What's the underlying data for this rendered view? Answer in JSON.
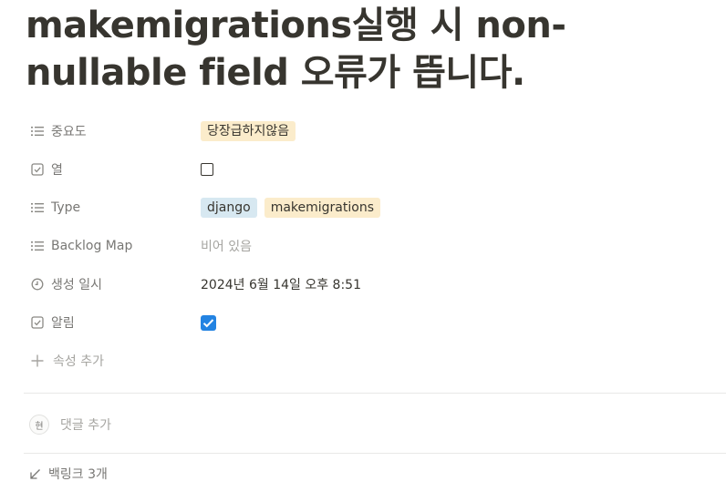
{
  "page": {
    "title": "makemigrations실행 시 non-nullable field 오류가 뜹니다."
  },
  "properties": [
    {
      "name": "중요도",
      "icon": "list-icon",
      "type": "select",
      "tags": [
        {
          "label": "당장급하지않음",
          "color": "#fbeccb"
        }
      ]
    },
    {
      "name": "열",
      "icon": "checkbox-icon",
      "type": "checkbox",
      "checked": false
    },
    {
      "name": "Type",
      "icon": "list-icon",
      "type": "multi_select",
      "tags": [
        {
          "label": "django",
          "color": "#d7e8f1"
        },
        {
          "label": "makemigrations",
          "color": "#fbeccb"
        }
      ]
    },
    {
      "name": "Backlog Map",
      "icon": "list-icon",
      "type": "empty",
      "value": "비어 있음"
    },
    {
      "name": "생성 일시",
      "icon": "clock-icon",
      "type": "date",
      "value": "2024년 6월 14일 오후 8:51"
    },
    {
      "name": "알림",
      "icon": "checkbox-icon",
      "type": "checkbox",
      "checked": true
    }
  ],
  "add_property_label": "속성 추가",
  "comment": {
    "avatar_initial": "현",
    "placeholder": "댓글 추가"
  },
  "backlinks": {
    "label": "백링크 3개"
  },
  "colors": {
    "accent": "#2383e2",
    "tag_yellow": "#fbeccb",
    "tag_blue": "#d7e8f1"
  }
}
